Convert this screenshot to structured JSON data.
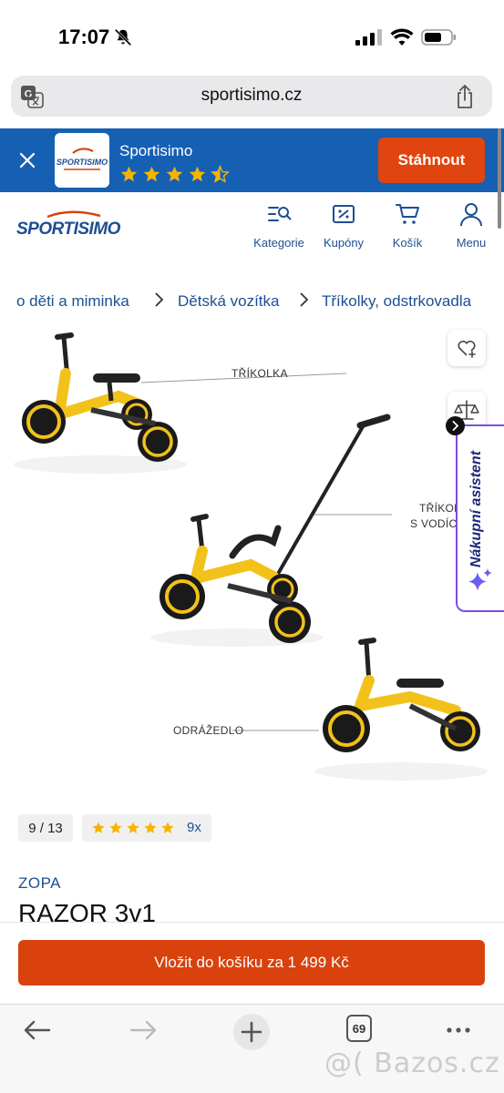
{
  "status_bar": {
    "time": "17:07"
  },
  "browser": {
    "url": "sportisimo.cz",
    "tabs_count": "69"
  },
  "app_banner": {
    "app_name": "Sportisimo",
    "logo_text": "SPORTISIMO",
    "rating": 4.5,
    "download_label": "Stáhnout"
  },
  "header": {
    "logo_text": "SPORTISIMO",
    "nav": [
      {
        "label": "Kategorie",
        "icon": "category-search-icon"
      },
      {
        "label": "Kupóny",
        "icon": "coupon-icon"
      },
      {
        "label": "Košík",
        "icon": "cart-icon"
      },
      {
        "label": "Menu",
        "icon": "user-icon"
      }
    ]
  },
  "breadcrumb": [
    "o děti a miminka",
    "Dětská vozítka",
    "Tříkolky, odstrkovadla"
  ],
  "product_image": {
    "labels": [
      "TŘÍKOLKA",
      "TŘÍKOL",
      "S VODÍC",
      "ODRÁŽEDLO"
    ]
  },
  "assistant": {
    "label": "Nákupní asistent"
  },
  "gallery": {
    "counter": "9 / 13"
  },
  "rating": {
    "stars": 5,
    "count": "9x"
  },
  "product": {
    "brand": "ZOPA",
    "title": "RAZOR 3v1"
  },
  "cart": {
    "button_label": "Vložit do košíku za 1 499 Kč"
  },
  "watermark": "@( Bazos.cz",
  "colors": {
    "brand_blue": "#1660b4",
    "accent_orange": "#e0450f",
    "star_yellow": "#f5b400",
    "bike_yellow": "#f2c21a"
  }
}
